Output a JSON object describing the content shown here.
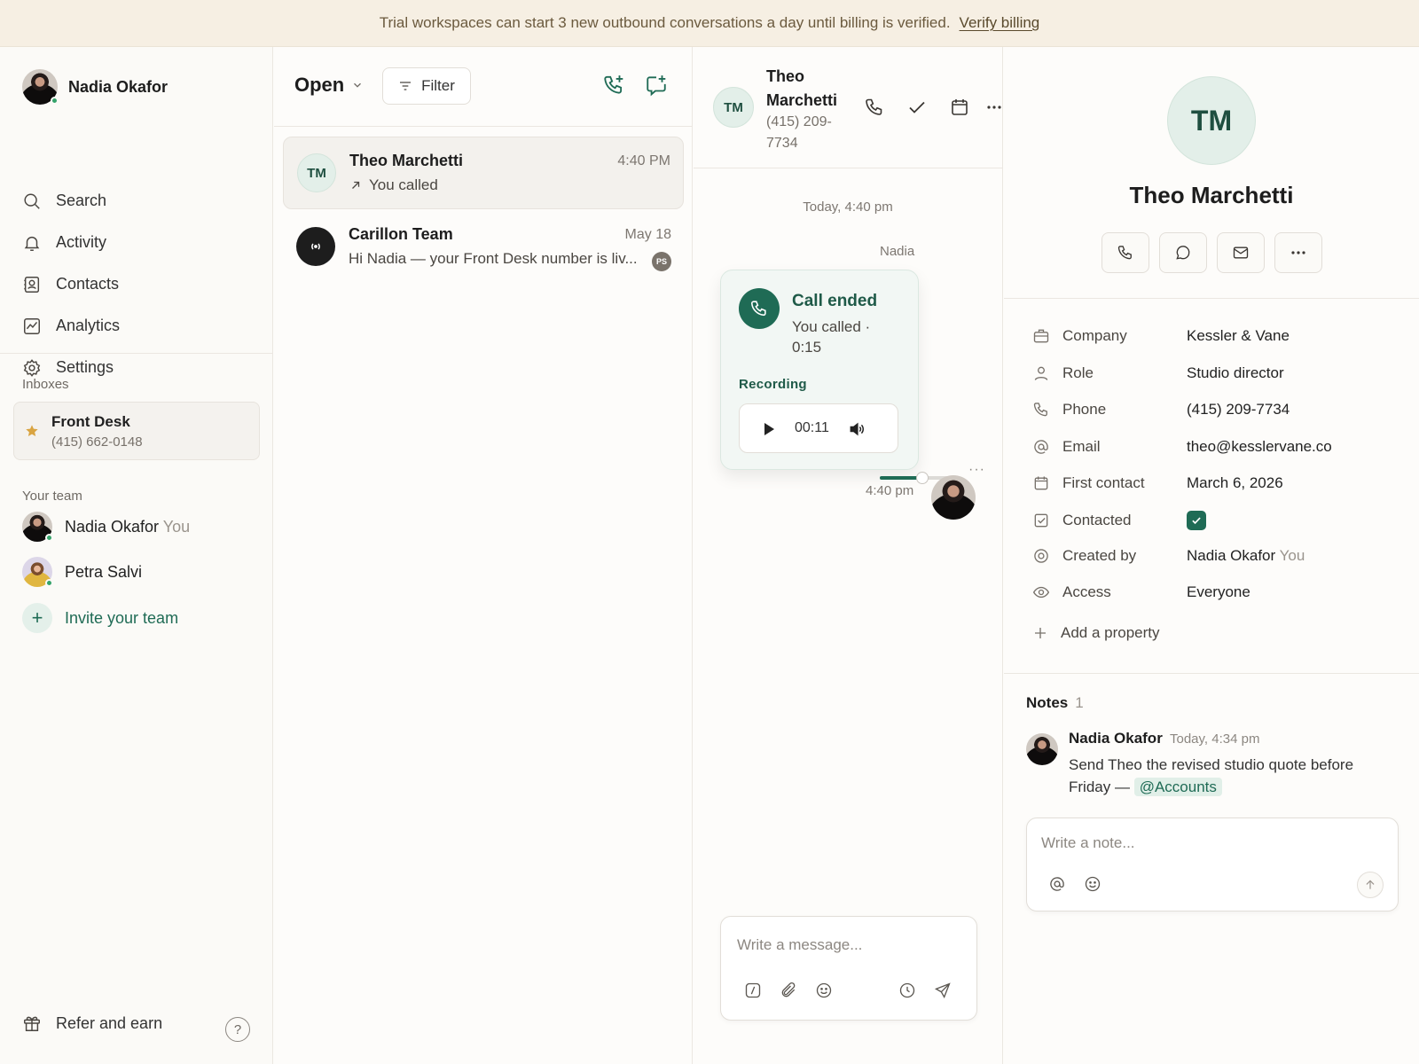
{
  "banner": {
    "text": "Trial workspaces can start 3 new outbound conversations a day until billing is verified.",
    "link": "Verify billing"
  },
  "sidebar": {
    "user_name": "Nadia Okafor",
    "nav": [
      {
        "label": "Search",
        "icon": "search-icon"
      },
      {
        "label": "Activity",
        "icon": "bell-icon"
      },
      {
        "label": "Contacts",
        "icon": "contacts-icon"
      },
      {
        "label": "Analytics",
        "icon": "analytics-icon"
      },
      {
        "label": "Settings",
        "icon": "gear-icon"
      }
    ],
    "inboxes_label": "Inboxes",
    "inbox": {
      "name": "Front Desk",
      "number": "(415) 662-0148"
    },
    "team_label": "Your team",
    "team": [
      {
        "name": "Nadia Okafor",
        "tag": "You"
      },
      {
        "name": "Petra Salvi",
        "tag": ""
      }
    ],
    "invite": "Invite your team",
    "refer": "Refer and earn",
    "help": "?"
  },
  "conv_list": {
    "status": "Open",
    "filter": "Filter",
    "items": [
      {
        "initials": "TM",
        "name": "Theo Marchetti",
        "time": "4:40 PM",
        "preview": "You called"
      },
      {
        "initials": "",
        "name": "Carillon Team",
        "time": "May 18",
        "preview": "Hi Nadia — your Front Desk number is liv...",
        "badge": "PS"
      }
    ]
  },
  "chat": {
    "initials": "TM",
    "name": "Theo Marchetti",
    "phone": "(415) 209-7734",
    "date": "Today, 4:40 pm",
    "sender": "Nadia",
    "call": {
      "title": "Call ended",
      "subtitle": "You called · 0:15",
      "recording_label": "Recording",
      "position": "00:11",
      "progress": 0.6
    },
    "dots": "···",
    "time": "4:40 pm",
    "composer_placeholder": "Write a message..."
  },
  "details": {
    "initials": "TM",
    "name": "Theo Marchetti",
    "properties": [
      {
        "label": "Company",
        "value": "Kessler & Vane",
        "icon": "briefcase-icon"
      },
      {
        "label": "Role",
        "value": "Studio director",
        "icon": "person-icon"
      },
      {
        "label": "Phone",
        "value": "(415) 209-7734",
        "icon": "phone-icon"
      },
      {
        "label": "Email",
        "value": "theo@kesslervane.co",
        "icon": "at-icon"
      },
      {
        "label": "First contact",
        "value": "March 6, 2026",
        "icon": "calendar-icon"
      },
      {
        "label": "Contacted",
        "value": "",
        "checked": true,
        "icon": "checkbox-icon"
      },
      {
        "label": "Created by",
        "value": "Nadia Okafor",
        "tag": "You",
        "icon": "target-icon"
      },
      {
        "label": "Access",
        "value": "Everyone",
        "icon": "eye-icon"
      }
    ],
    "add_property": "Add a property",
    "notes_label": "Notes",
    "notes_count": "1",
    "note": {
      "author": "Nadia Okafor",
      "time": "Today, 4:34 pm",
      "text": "Send Theo the revised studio quote before Friday —",
      "mention": "@Accounts"
    },
    "note_placeholder": "Write a note..."
  },
  "colors": {
    "accent": "#1f6b55",
    "banner_bg": "#f6efe3",
    "online": "#35a36b"
  }
}
